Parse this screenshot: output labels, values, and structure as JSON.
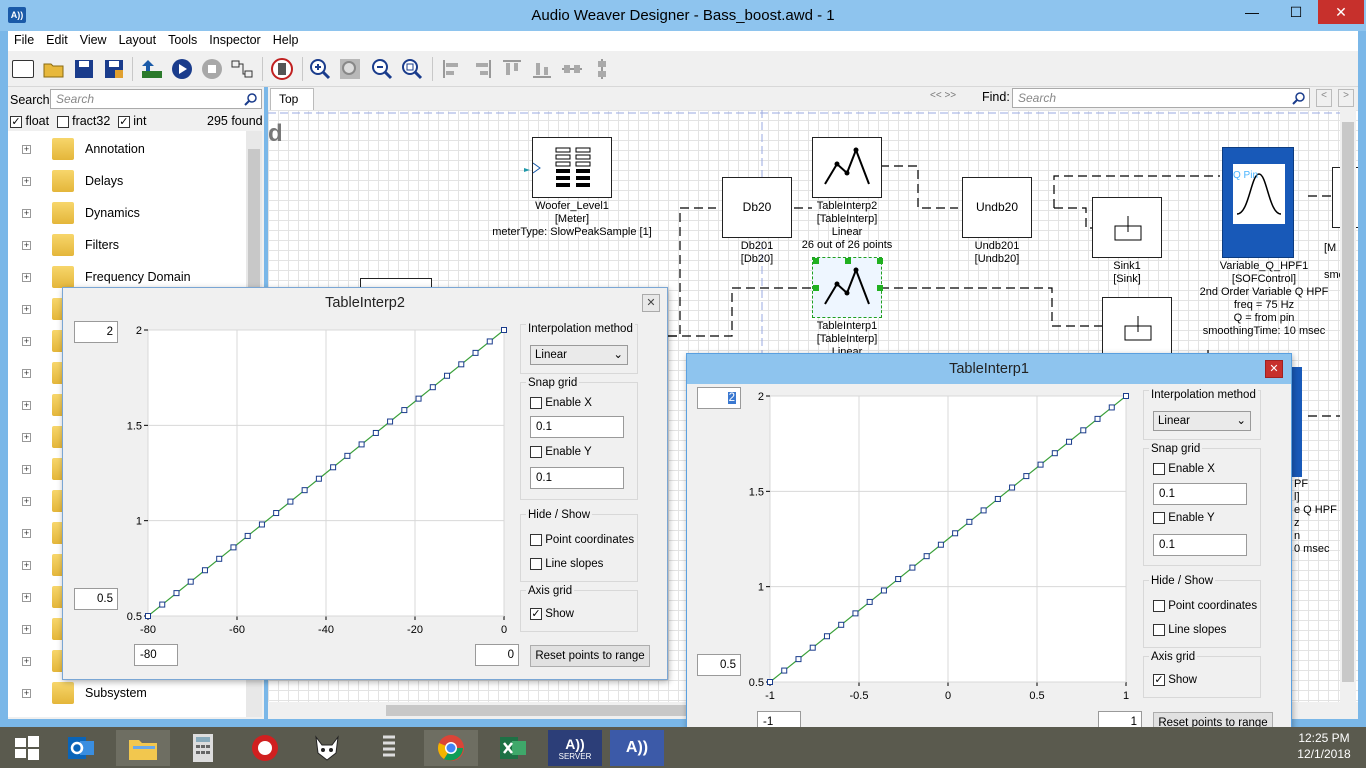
{
  "window": {
    "title": "Audio Weaver Designer - Bass_boost.awd - 1",
    "icon": "aw-logo-icon"
  },
  "menu": [
    "File",
    "Edit",
    "View",
    "Layout",
    "Tools",
    "Inspector",
    "Help"
  ],
  "search": {
    "label": "Search:",
    "placeholder": "Search"
  },
  "filters": {
    "float": "float",
    "fract32": "fract32",
    "int": "int",
    "found": "295 found"
  },
  "tree": [
    "Annotation",
    "Delays",
    "Dynamics",
    "Filters",
    "Frequency Domain",
    "Subsystem"
  ],
  "tab": "Top",
  "find": {
    "label": "Find:",
    "placeholder": "Search"
  },
  "canvas_fragment": "d",
  "blocks": {
    "woofer": [
      "Woofer_Level1",
      "[Meter]",
      "meterType: SlowPeakSample [1]"
    ],
    "db20_name": "Db20",
    "db20": [
      "Db201",
      "[Db20]"
    ],
    "ti2": [
      "TableInterp2",
      "[TableInterp]",
      "Linear",
      "26 out of 26 points"
    ],
    "undb_name": "Undb20",
    "undb": [
      "Undb201",
      "[Undb20]"
    ],
    "sink": [
      "Sink1",
      "[Sink]"
    ],
    "vq_pin": "Q Pin",
    "vq": [
      "Variable_Q_HPF1",
      "[SOFControl]",
      "2nd Order Variable Q HPF",
      "freq = 75 Hz",
      "Q = from pin",
      "smoothingTime: 10 msec"
    ],
    "ti1": [
      "TableInterp1",
      "[TableInterp]",
      "Linear"
    ],
    "partial_right": [
      "[M",
      "smoot"
    ],
    "partial_hidden": [
      "PF",
      "l]",
      "e Q HPF",
      "z",
      "n",
      "0 msec"
    ]
  },
  "dialog2": {
    "title": "TableInterp2",
    "ymax_input": "2",
    "ymin_input": "0.5",
    "xmin_input": "-80",
    "xmax_input": "0",
    "interp_label": "Interpolation method",
    "interp_value": "Linear",
    "snap_label": "Snap grid",
    "enable_x": "Enable X",
    "snap_x": "0.1",
    "enable_y": "Enable Y",
    "snap_y": "0.1",
    "hide_label": "Hide / Show",
    "point_coords": "Point coordinates",
    "line_slopes": "Line slopes",
    "axis_label": "Axis grid",
    "show": "Show",
    "show_checked": true,
    "reset": "Reset points to range"
  },
  "dialog1": {
    "title": "TableInterp1",
    "ymax_input": "2",
    "ymin_input": "0.5",
    "xmin_input": "-1",
    "xmax_input": "1",
    "interp_label": "Interpolation method",
    "interp_value": "Linear",
    "snap_label": "Snap grid",
    "enable_x": "Enable X",
    "snap_x": "0.1",
    "enable_y": "Enable Y",
    "snap_y": "0.1",
    "hide_label": "Hide / Show",
    "point_coords": "Point coordinates",
    "line_slopes": "Line slopes",
    "axis_label": "Axis grid",
    "show": "Show",
    "show_checked": true,
    "reset": "Reset points to range"
  },
  "chart_data": [
    {
      "type": "line",
      "x": {
        "min": -80,
        "max": 0,
        "points": 26
      },
      "ylim": [
        0.5,
        2
      ],
      "xlim": [
        -80,
        0
      ],
      "xticks": [
        -80,
        -60,
        -40,
        -20,
        0
      ],
      "yticks": [
        0.5,
        1,
        1.5,
        2
      ],
      "xtick_labels": [
        "-80",
        "-60",
        "-40",
        "-20",
        "0"
      ],
      "ytick_labels": [
        "0.5",
        "1",
        "1.5",
        "2"
      ],
      "y_start": 0.5,
      "y_end": 2,
      "grid": true,
      "line_color": "#3aa03a",
      "marker_color": "#1a3c8c"
    },
    {
      "type": "line",
      "x": {
        "min": -1,
        "max": 1,
        "points": 26
      },
      "ylim": [
        0.5,
        2
      ],
      "xlim": [
        -1,
        1
      ],
      "xticks": [
        -1,
        -0.5,
        0,
        0.5,
        1
      ],
      "yticks": [
        0.5,
        1,
        1.5,
        2
      ],
      "xtick_labels": [
        "-1",
        "-0.5",
        "0",
        "0.5",
        "1"
      ],
      "ytick_labels": [
        "0.5",
        "1",
        "1.5",
        "2"
      ],
      "y_start": 0.5,
      "y_end": 2,
      "grid": true,
      "line_color": "#3aa03a",
      "marker_color": "#1a3c8c"
    }
  ],
  "clock": {
    "time": "12:25 PM",
    "date": "12/1/2018"
  },
  "taskbar_apps": [
    "windows-start-icon",
    "outlook-icon",
    "file-explorer-icon",
    "calculator-icon",
    "app-c-icon",
    "mascot-icon",
    "app-spring-icon",
    "chrome-icon",
    "excel-icon",
    "aw-server-icon",
    "aw-designer-icon"
  ],
  "taskbar_server_label": "SERVER",
  "colors": {
    "titlebar": "#8ec4ee",
    "accent": "#1a5aa8",
    "block_selected": "#1859b8",
    "green_handle": "#20b020"
  }
}
